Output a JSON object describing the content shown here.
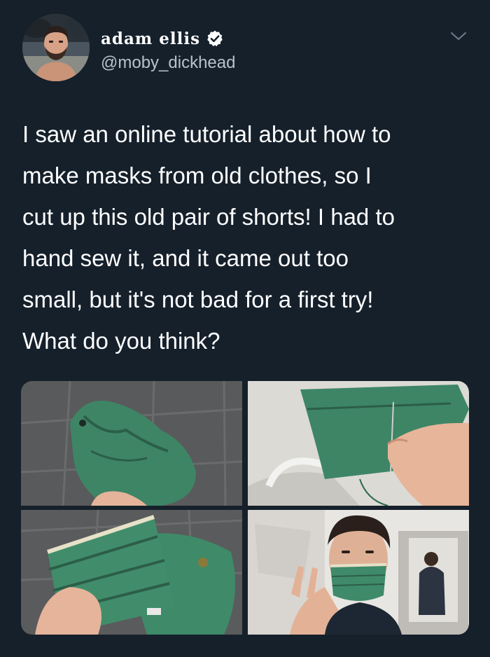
{
  "user": {
    "display_name": "adam ellis",
    "handle": "@moby_dickhead",
    "verified": true,
    "avatar_icon": "avatar"
  },
  "menu_icon": "chevron-down-icon",
  "tweet": {
    "text": "I saw an online tutorial about how to\nmake masks from old clothes, so I\ncut up this old pair of shorts! I had to\nhand sew it, and it came out too\nsmall, but it's not bad for a first try!\nWhat do you think?"
  },
  "colors": {
    "background": "#15202b",
    "text": "#ffffff",
    "secondary_text": "#b7c2cc",
    "fabric_green": "#3e8566"
  },
  "media": {
    "count": 4,
    "photos": [
      {
        "subject": "green shorts on tile floor"
      },
      {
        "subject": "hand sewing green fabric"
      },
      {
        "subject": "finished pleated mask held in hand"
      },
      {
        "subject": "man wearing mask giving peace sign"
      }
    ]
  }
}
